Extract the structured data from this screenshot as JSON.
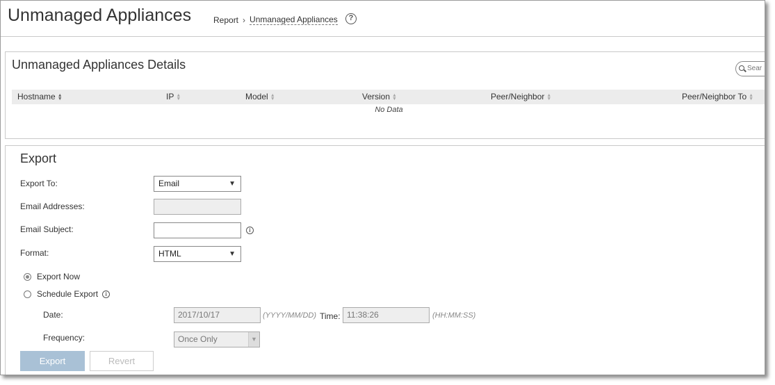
{
  "header": {
    "title": "Unmanaged Appliances",
    "breadcrumb": {
      "parent": "Report",
      "separator": "›",
      "current": "Unmanaged Appliances"
    },
    "help_icon": "?"
  },
  "details": {
    "title": "Unmanaged Appliances Details",
    "search_placeholder": "Sear",
    "columns": [
      "Hostname",
      "IP",
      "Model",
      "Version",
      "Peer/Neighbor",
      "Peer/Neighbor To"
    ],
    "empty_text": "No Data"
  },
  "export": {
    "title": "Export",
    "export_to": {
      "label": "Export To:",
      "value": "Email"
    },
    "email_addresses": {
      "label": "Email Addresses:",
      "value": ""
    },
    "email_subject": {
      "label": "Email Subject:",
      "value": ""
    },
    "format": {
      "label": "Format:",
      "value": "HTML"
    },
    "export_now": {
      "label": "Export Now",
      "checked": true
    },
    "schedule_export": {
      "label": "Schedule Export",
      "checked": false
    },
    "date": {
      "label": "Date:",
      "value": "2017/10/17",
      "hint": "(YYYY/MM/DD)"
    },
    "time": {
      "label": "Time:",
      "value": "11:38:26",
      "hint": "(HH:MM:SS)"
    },
    "frequency": {
      "label": "Frequency:",
      "value": "Once Only"
    },
    "export_button": "Export",
    "revert_button": "Revert"
  },
  "icons": {
    "info": "i",
    "dropdown": "▼",
    "sort": "▲▼"
  },
  "colors": {
    "export_button_bg": "#a9c1d6",
    "grid_header_bg": "#ececec",
    "border": "#c9c9c9"
  }
}
